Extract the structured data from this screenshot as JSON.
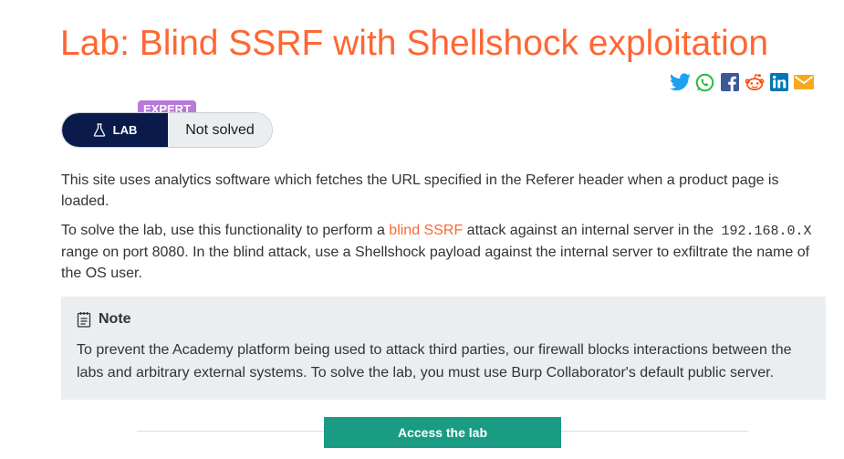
{
  "lab": {
    "title": "Lab: Blind SSRF with Shellshock exploitation",
    "level": "EXPERT",
    "badge_label": "LAB",
    "status": "Not solved"
  },
  "share_icons": [
    "twitter-icon",
    "whatsapp-icon",
    "facebook-icon",
    "reddit-icon",
    "linkedin-icon",
    "email-icon"
  ],
  "description": {
    "p1": "This site uses analytics software which fetches the URL specified in the Referer header when a product page is loaded.",
    "p2_before": "To solve the lab, use this functionality to perform a ",
    "p2_link": "blind SSRF",
    "p2_middle": " attack against an internal server in the ",
    "p2_code": "192.168.0.X",
    "p2_after": " range on port 8080. In the blind attack, use a Shellshock payload against the internal server to exfiltrate the name of the OS user."
  },
  "note": {
    "heading": "Note",
    "body": "To prevent the Academy platform being used to attack third parties, our firewall blocks interactions between the labs and arbitrary external systems. To solve the lab, you must use Burp Collaborator's default public server."
  },
  "access_button": "Access the lab",
  "colors": {
    "accent": "#ff6633",
    "expert": "#b77ad8",
    "lab_badge": "#0a1a4a",
    "access_button": "#1a9c84",
    "note_bg": "#ebeef0"
  }
}
